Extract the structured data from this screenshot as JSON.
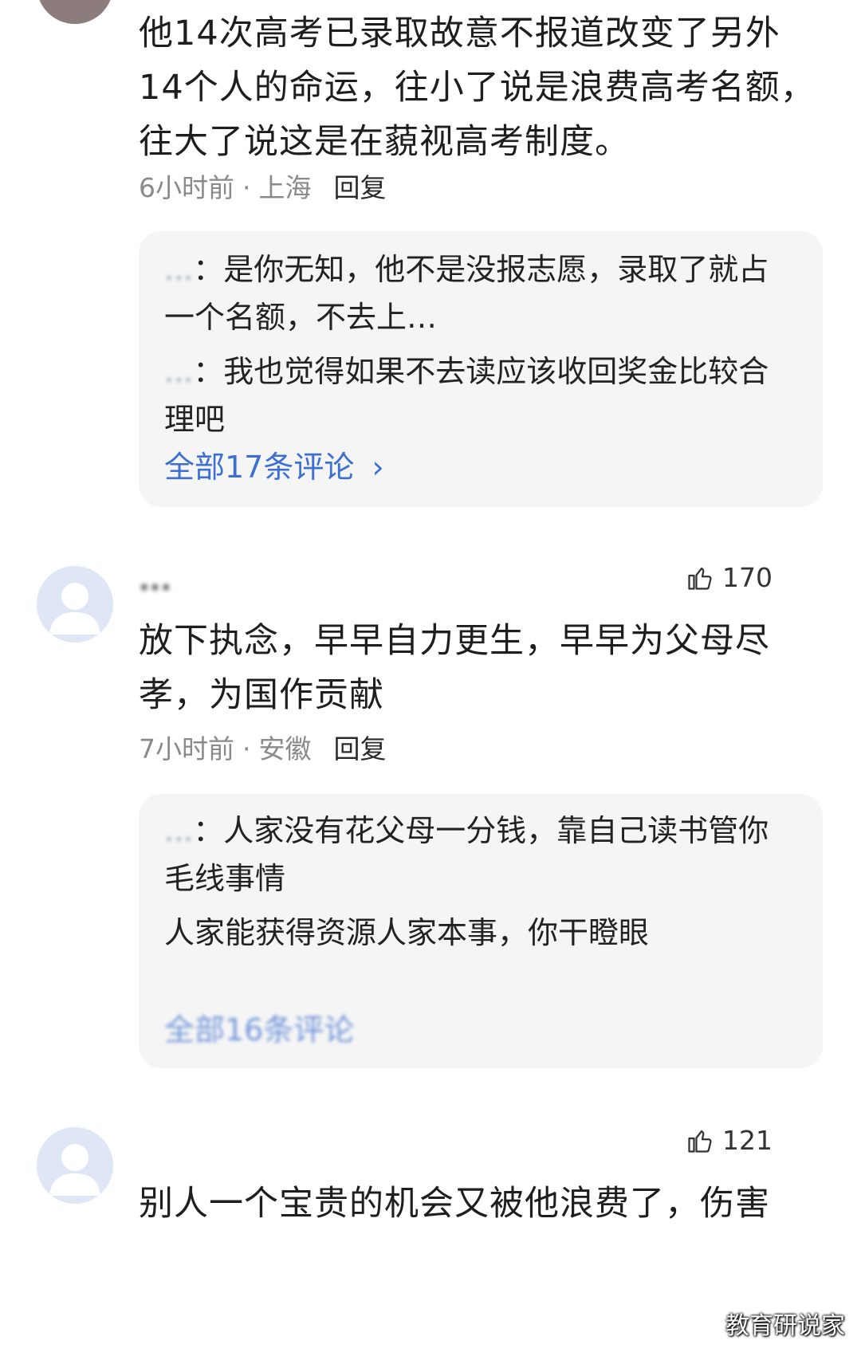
{
  "comments": [
    {
      "text": "他14次高考已录取故意不报道改变了另外14个人的命运，往小了说是浪费高考名额，往大了说这是在藐视高考制度。",
      "time": "6小时前",
      "sep": "·",
      "location": "上海",
      "reply_label": "回复",
      "replies": [
        {
          "name": "...",
          "text": "是你无知，他不是没报志愿，录取了就占一个名额，不去上…"
        },
        {
          "name": "...",
          "text": "我也觉得如果不去读应该收回奖金比较合理吧"
        }
      ],
      "all_comments": "全部17条评论",
      "all_arrow": "›"
    },
    {
      "username": "...",
      "likes": "170",
      "text": "放下执念，早早自力更生，早早为父母尽孝，为国作贡献",
      "time": "7小时前",
      "sep": "·",
      "location": "安徽",
      "reply_label": "回复",
      "replies": [
        {
          "name": "...",
          "text": "人家没有花父母一分钱，靠自己读书管你毛线事情"
        },
        {
          "name": "",
          "text": "人家能获得资源人家本事，你干瞪眼"
        }
      ],
      "all_comments": "全部16条评论"
    },
    {
      "likes": "121",
      "text": "别人一个宝贵的机会又被他浪费了，伤害"
    }
  ],
  "watermark": "教育研说家",
  "colors": {
    "link": "#3c6fd1",
    "meta": "#8a8a8a",
    "reply_box_bg": "#f5f5f5",
    "avatar_bg": "#dfe6f6"
  }
}
